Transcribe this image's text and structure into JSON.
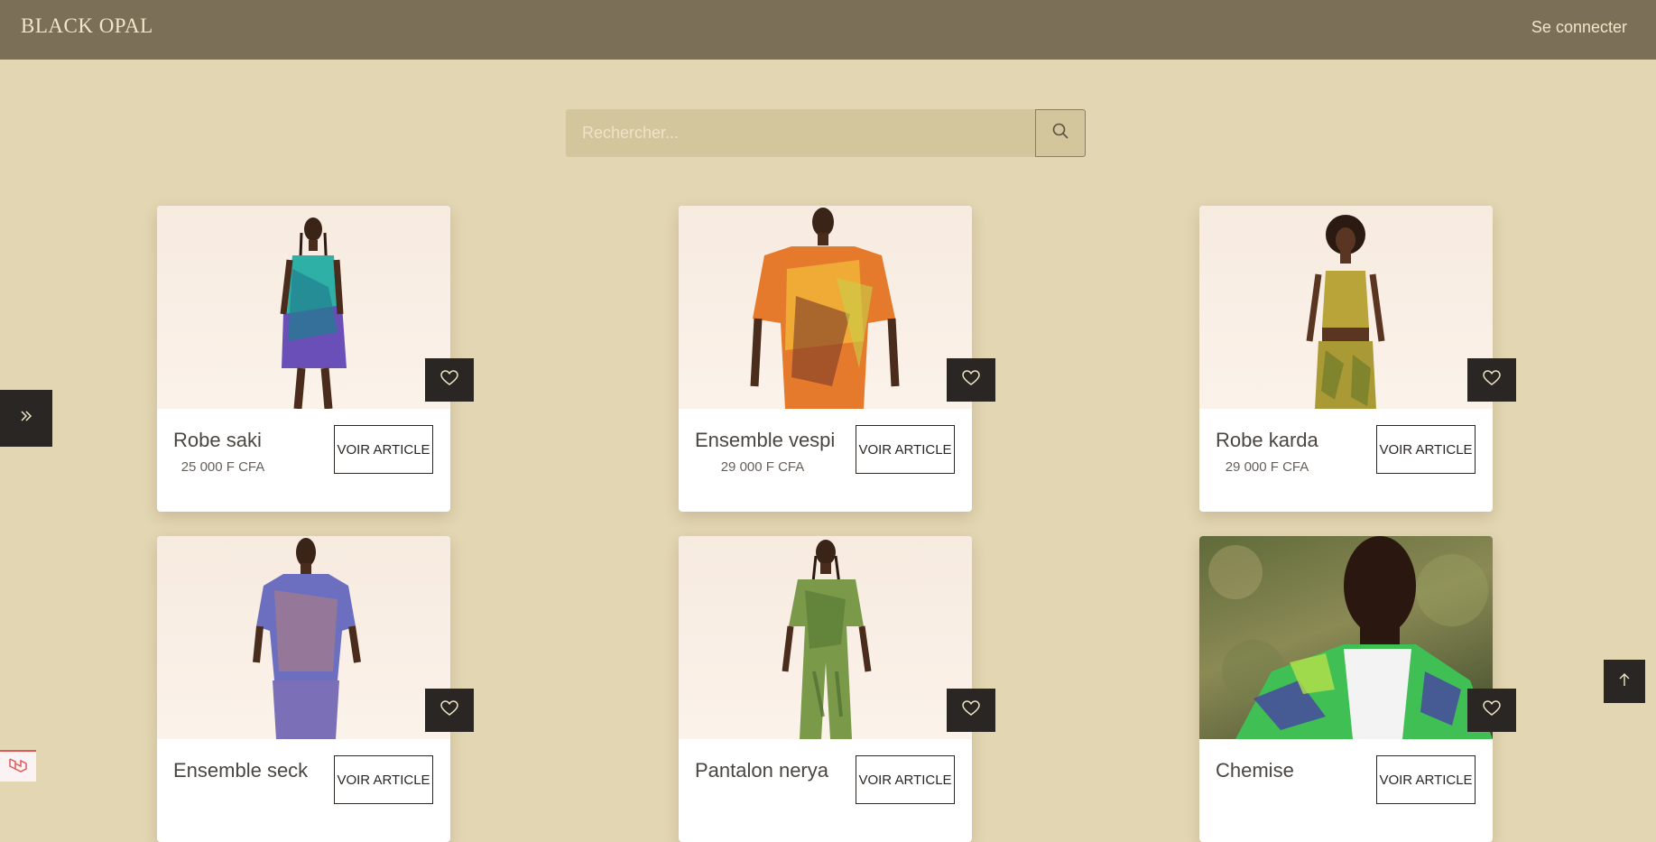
{
  "header": {
    "brand": "BLACK OPAL",
    "login_label": "Se connecter"
  },
  "search": {
    "placeholder": "Rechercher...",
    "button_icon": "search-icon"
  },
  "products": [
    {
      "name": "Robe saki",
      "price": "25 000 F CFA",
      "button_label": "VOIR ARTICLE",
      "favorite_icon": "heart-icon"
    },
    {
      "name": "Ensemble vespi",
      "price": "29 000 F CFA",
      "button_label": "VOIR ARTICLE",
      "favorite_icon": "heart-icon"
    },
    {
      "name": "Robe karda",
      "price": "29 000 F CFA",
      "button_label": "VOIR ARTICLE",
      "favorite_icon": "heart-icon"
    },
    {
      "name": "Ensemble seck",
      "price": "",
      "button_label": "VOIR ARTICLE",
      "favorite_icon": "heart-icon"
    },
    {
      "name": "Pantalon nerya",
      "price": "",
      "button_label": "VOIR ARTICLE",
      "favorite_icon": "heart-icon"
    },
    {
      "name": "Chemise",
      "price": "",
      "button_label": "VOIR ARTICLE",
      "favorite_icon": "heart-icon"
    }
  ],
  "controls": {
    "sidebar_toggle_icon": "double-chevron-right-icon",
    "scroll_top_icon": "arrow-up-icon",
    "debug_icon": "laravel-logo-icon"
  },
  "colors": {
    "page_bg": "#e3d6b2",
    "header_bg": "#7b6f57",
    "dark_button": "#2a2624",
    "search_bg": "#d3c59c"
  }
}
